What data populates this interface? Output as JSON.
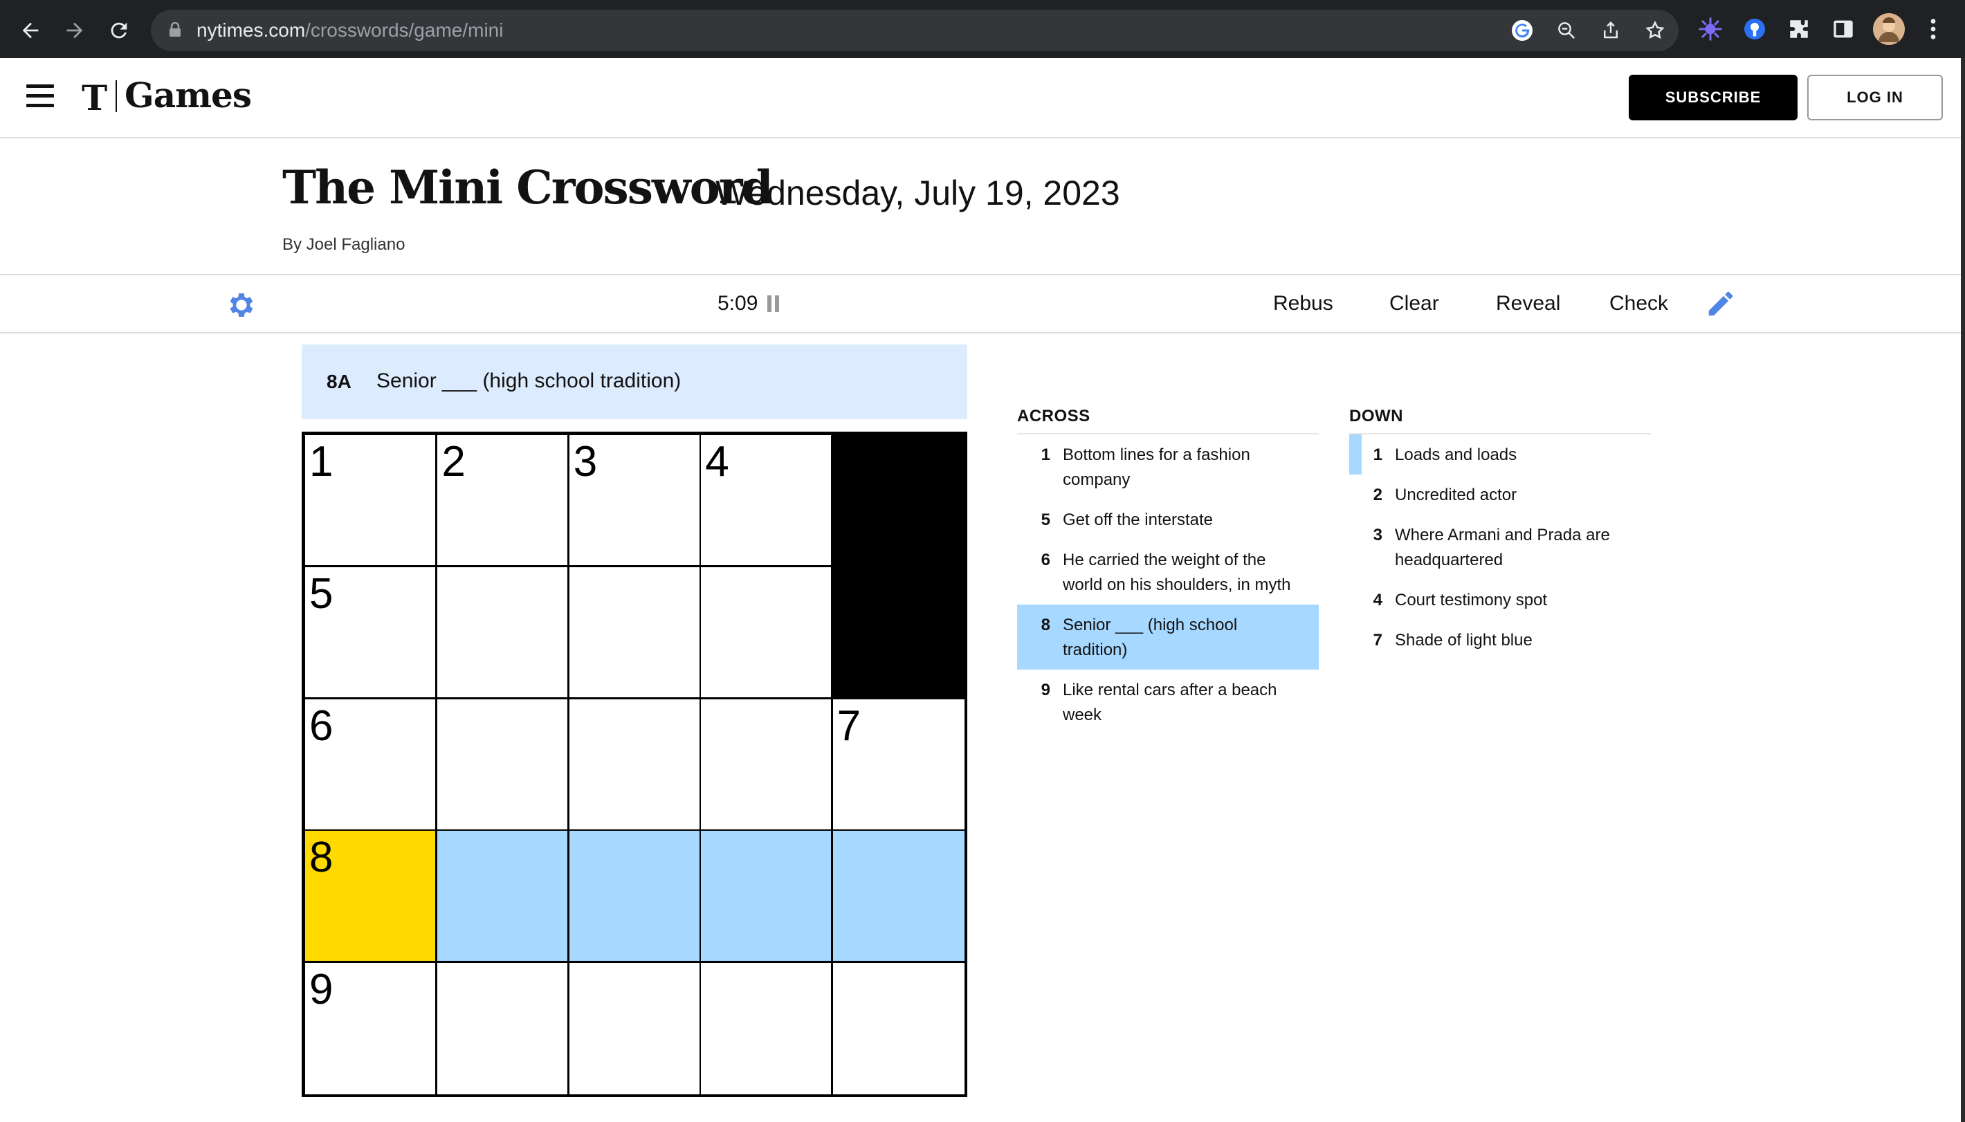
{
  "browser": {
    "url_domain": "nytimes.com",
    "url_path": "/crosswords/game/mini",
    "icons": [
      "back-icon",
      "forward-icon",
      "reload-icon",
      "lock-icon",
      "google-icon",
      "zoom-icon",
      "share-icon",
      "star-icon",
      "extension-icon",
      "password-icon",
      "puzzle-icon",
      "sidepanel-icon",
      "profile-avatar",
      "menu-icon"
    ]
  },
  "header": {
    "logo_t": "T",
    "logo_text": "Games",
    "subscribe_label": "SUBSCRIBE",
    "login_label": "LOG IN"
  },
  "puzzle": {
    "title": "The Mini Crossword",
    "date": "Wednesday, July 19, 2023",
    "byline": "By Joel Fagliano"
  },
  "toolbar": {
    "timer": "5:09",
    "rebus": "Rebus",
    "clear": "Clear",
    "reveal": "Reveal",
    "check": "Check"
  },
  "current_clue": {
    "label": "8A",
    "text": "Senior ___ (high school tradition)"
  },
  "grid": {
    "size": 5,
    "cells": [
      [
        {
          "num": "1"
        },
        {
          "num": "2"
        },
        {
          "num": "3"
        },
        {
          "num": "4"
        },
        {
          "black": true
        }
      ],
      [
        {
          "num": "5"
        },
        {},
        {},
        {},
        {
          "black": true
        }
      ],
      [
        {
          "num": "6"
        },
        {},
        {},
        {},
        {
          "num": "7"
        }
      ],
      [
        {
          "num": "8",
          "state": "active"
        },
        {
          "state": "word"
        },
        {
          "state": "word"
        },
        {
          "state": "word"
        },
        {
          "state": "word"
        }
      ],
      [
        {
          "num": "9"
        },
        {},
        {},
        {},
        {}
      ]
    ]
  },
  "clues": {
    "across_title": "ACROSS",
    "down_title": "DOWN",
    "across": [
      {
        "num": "1",
        "text": "Bottom lines for a fashion company"
      },
      {
        "num": "5",
        "text": "Get off the interstate"
      },
      {
        "num": "6",
        "text": "He carried the weight of the world on his shoulders, in myth"
      },
      {
        "num": "8",
        "text": "Senior ___ (high school tradition)",
        "selected": true
      },
      {
        "num": "9",
        "text": "Like rental cars after a beach week"
      }
    ],
    "down": [
      {
        "num": "1",
        "text": "Loads and loads",
        "cross": true
      },
      {
        "num": "2",
        "text": "Uncredited actor"
      },
      {
        "num": "3",
        "text": "Where Armani and Prada are headquartered"
      },
      {
        "num": "4",
        "text": "Court testimony spot"
      },
      {
        "num": "7",
        "text": "Shade of light blue"
      }
    ]
  },
  "colors": {
    "active_cell": "#ffda00",
    "word_highlight": "#a7d8ff",
    "clue_bar": "#dcebfd",
    "accent_blue": "#4f85e5"
  }
}
